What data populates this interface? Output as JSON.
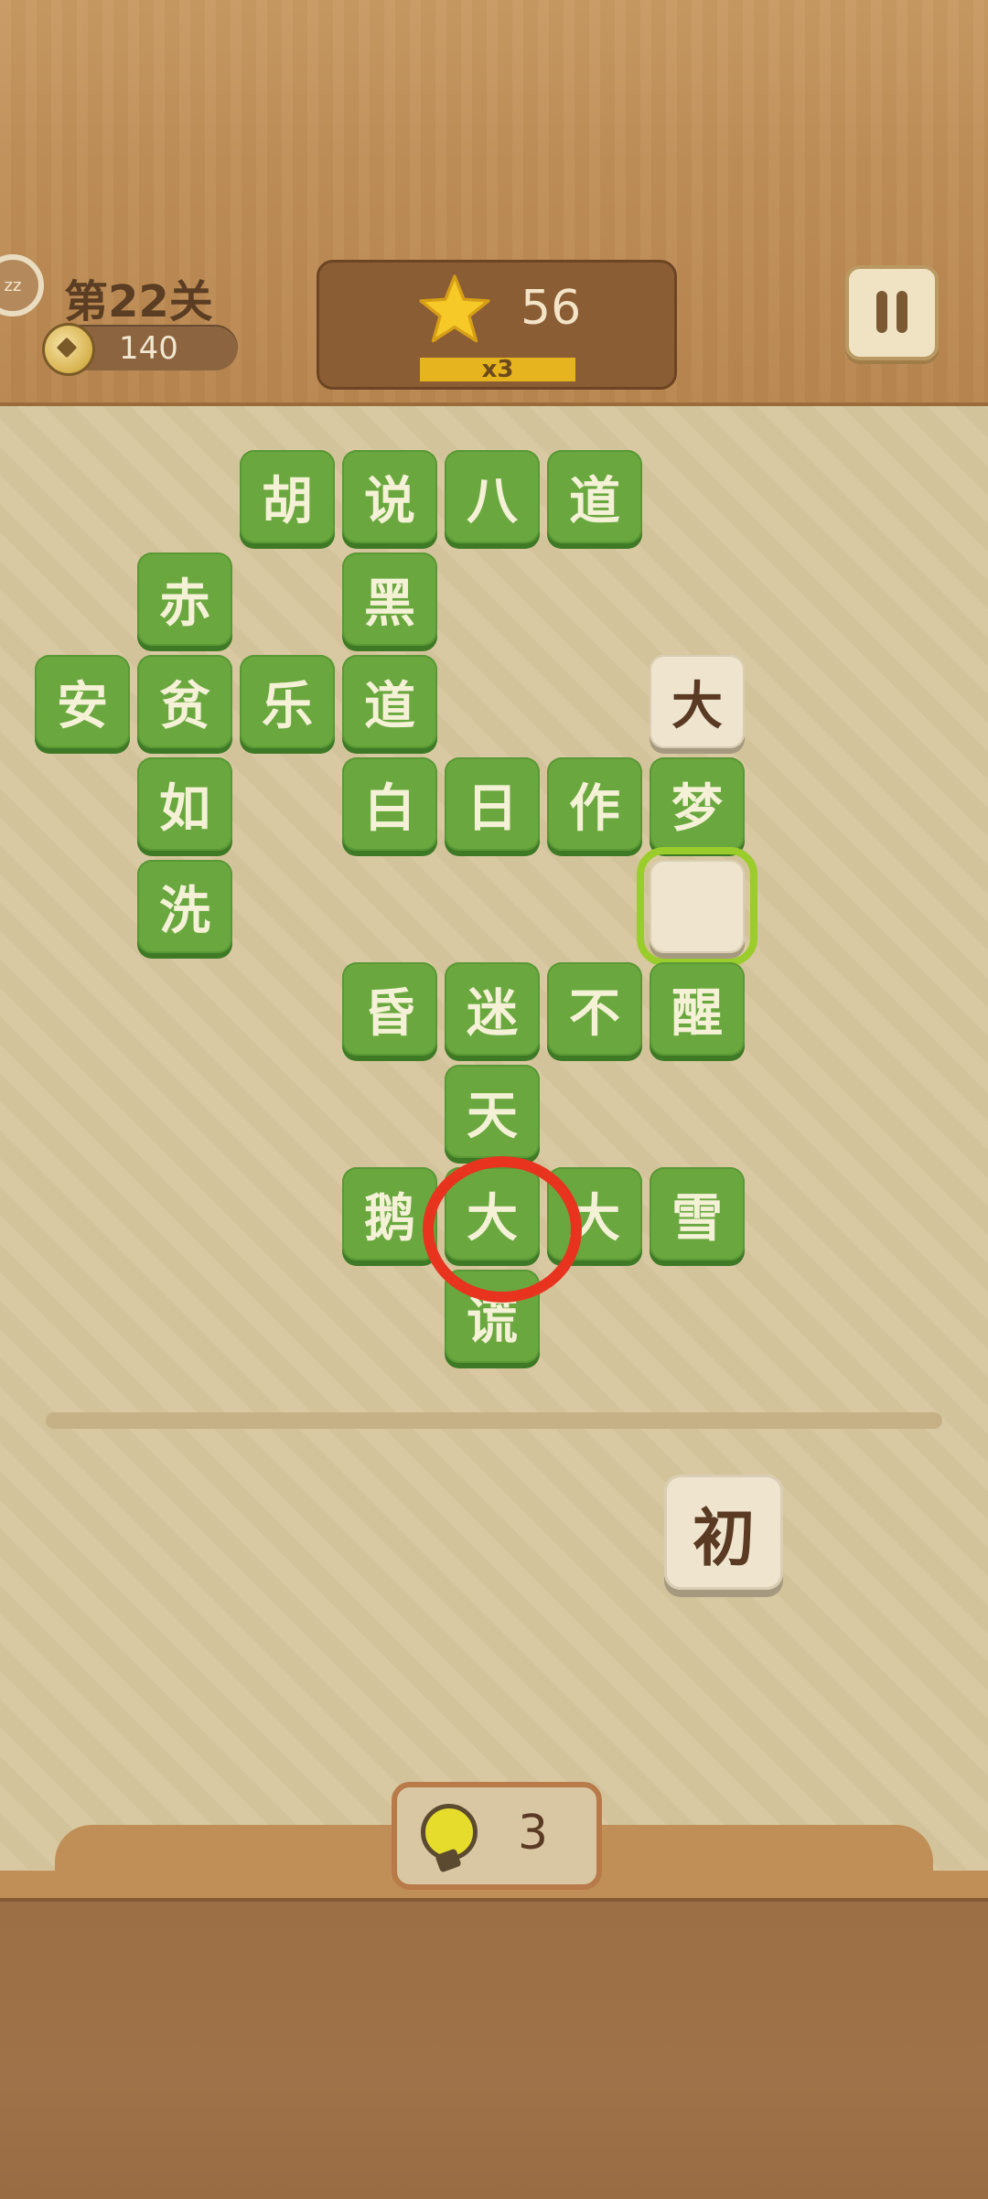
{
  "header": {
    "sleep_icon_label": "zz",
    "level_title": "第22关",
    "coins": "140",
    "score": "56",
    "multiplier": "x3"
  },
  "board": {
    "tiles": [
      {
        "text": "胡",
        "style": "green"
      },
      {
        "text": "说",
        "style": "green"
      },
      {
        "text": "八",
        "style": "green"
      },
      {
        "text": "道",
        "style": "green"
      },
      {
        "text": "赤",
        "style": "green"
      },
      {
        "text": "黑",
        "style": "green"
      },
      {
        "text": "安",
        "style": "green"
      },
      {
        "text": "贫",
        "style": "green"
      },
      {
        "text": "乐",
        "style": "green"
      },
      {
        "text": "道",
        "style": "green"
      },
      {
        "text": "大",
        "style": "beige"
      },
      {
        "text": "如",
        "style": "green"
      },
      {
        "text": "白",
        "style": "green"
      },
      {
        "text": "日",
        "style": "green"
      },
      {
        "text": "作",
        "style": "green"
      },
      {
        "text": "梦",
        "style": "green"
      },
      {
        "text": "洗",
        "style": "green"
      },
      {
        "text": "",
        "style": "beige",
        "selected": true
      },
      {
        "text": "昏",
        "style": "green"
      },
      {
        "text": "迷",
        "style": "green"
      },
      {
        "text": "不",
        "style": "green"
      },
      {
        "text": "醒",
        "style": "green"
      },
      {
        "text": "天",
        "style": "green"
      },
      {
        "text": "鹅",
        "style": "green"
      },
      {
        "text": "大",
        "style": "green",
        "circled": true
      },
      {
        "text": "大",
        "style": "green"
      },
      {
        "text": "雪",
        "style": "green"
      },
      {
        "text": "谎",
        "style": "green"
      }
    ]
  },
  "choices": [
    "初"
  ],
  "hint": {
    "count": "3"
  },
  "colors": {
    "tile_green": "#6aa83f",
    "tile_beige": "#efe5cf",
    "highlight_circle": "#e8331f",
    "selected_outline": "#9acd2b"
  }
}
